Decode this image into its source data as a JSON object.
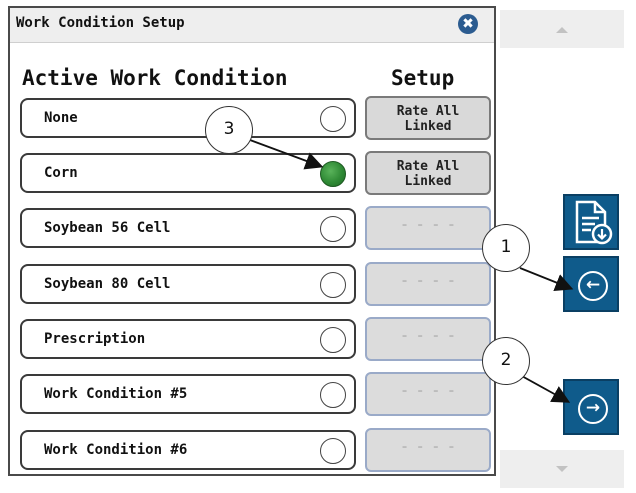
{
  "window": {
    "title": "Work Condition Setup",
    "close_icon": "✖"
  },
  "headers": {
    "active": "Active Work Condition",
    "setup": "Setup"
  },
  "rows": [
    {
      "label": "None",
      "selected": false,
      "setup_line1": "Rate All",
      "setup_line2": "Linked"
    },
    {
      "label": "Corn",
      "selected": true,
      "setup_line1": "Rate All",
      "setup_line2": "Linked"
    },
    {
      "label": "Soybean 56 Cell",
      "selected": false,
      "setup_placeholder": "- - - -"
    },
    {
      "label": "Soybean 80 Cell",
      "selected": false,
      "setup_placeholder": "- - - -"
    },
    {
      "label": "Prescription",
      "selected": false,
      "setup_placeholder": "- - - -"
    },
    {
      "label": "Work Condition #5",
      "selected": false,
      "setup_placeholder": "- - - -"
    },
    {
      "label": "Work Condition #6",
      "selected": false,
      "setup_placeholder": "- - - -"
    }
  ],
  "side_buttons": {
    "back_glyph": "←",
    "forward_glyph": "→"
  },
  "callouts": [
    "1",
    "2",
    "3"
  ],
  "colors": {
    "selected_radio": "#2f8a35",
    "nav_button": "#0f5b8b",
    "close_button": "#2c5c90"
  }
}
